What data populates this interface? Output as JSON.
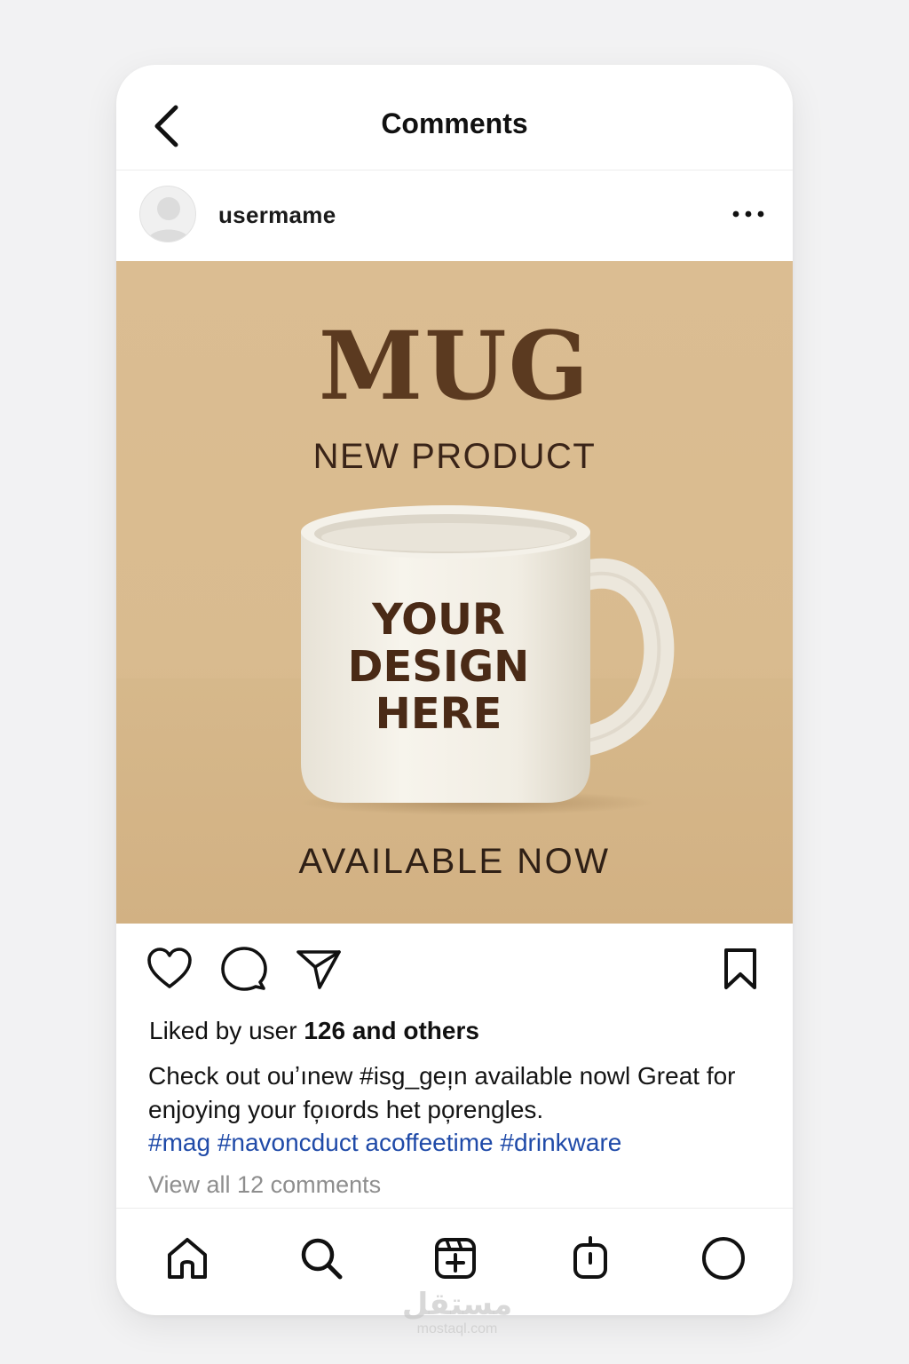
{
  "header": {
    "title": "Comments"
  },
  "post": {
    "username": "usermame",
    "image": {
      "headline": "MUG",
      "subheadline": "NEW PRODUCT",
      "mug_print": "YOUR\nDESIGN\nHERE",
      "footer": "AVAILABLE NOW"
    },
    "likes": {
      "prefix": "Liked by user ",
      "bold": "126 and others"
    },
    "caption": "Check out ouʼınew #isg_geı̦n available nowl Great for enjoying your fo̦ıords het po̦rengles.",
    "hashtags": "#mag #navoncduct acoffeetime #drinkware",
    "view_all": "View all 12 comments"
  },
  "icons": {
    "back": "chevron-left-icon",
    "more": "more-horizontal-icon",
    "like": "heart-icon",
    "comment": "comment-icon",
    "share": "send-icon",
    "save": "bookmark-icon",
    "nav": [
      "home-icon",
      "search-icon",
      "add-post-icon",
      "reels-icon",
      "profile-icon"
    ]
  },
  "colors": {
    "post_background": "#dbbd92",
    "headline": "#5b3a20",
    "hashtag": "#1f4aa8",
    "muted": "#8e8e8e"
  },
  "watermark": {
    "arabic": "مستقل",
    "url": "mostaql.com"
  }
}
